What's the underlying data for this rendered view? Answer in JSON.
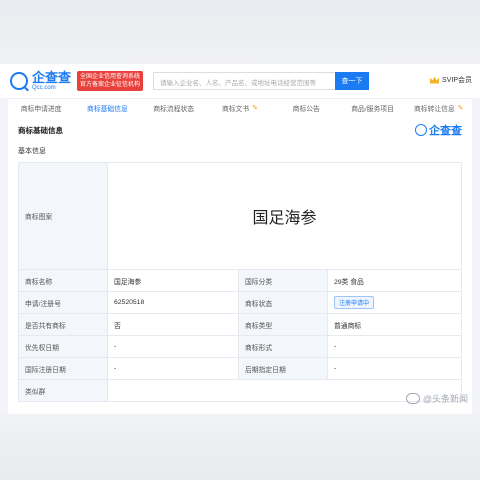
{
  "header": {
    "logo_cn": "企查查",
    "logo_en": "Qcc.com",
    "badge_line1": "全国企业信用查询系统",
    "badge_line2": "官方备案企业征信机构",
    "search_placeholder": "请输入企业名、人名、产品名、或地址电话经营范围等",
    "search_button": "查一下",
    "svip": "SVIP会员"
  },
  "tabs": [
    {
      "label": "商标申请进度",
      "vip": false
    },
    {
      "label": "商标基础信息",
      "vip": false
    },
    {
      "label": "商标流程状态",
      "vip": false
    },
    {
      "label": "商标文书",
      "vip": true
    },
    {
      "label": "商标公告",
      "vip": false
    },
    {
      "label": "商品/服务项目",
      "vip": false
    },
    {
      "label": "商标转让信息",
      "vip": true
    }
  ],
  "panel": {
    "title": "商标基础信息",
    "logo_text": "企查查",
    "section": "基本信息"
  },
  "details": {
    "image_label": "商标图案",
    "trademark_text": "国足海参",
    "rows": [
      {
        "k1": "商标名称",
        "v1": "国足海参",
        "k2": "国际分类",
        "v2": "29类 食品"
      },
      {
        "k1": "申请/注册号",
        "v1": "62520518",
        "k2": "商标状态",
        "v2": "注册申请中"
      },
      {
        "k1": "是否共有商标",
        "v1": "否",
        "k2": "商标类型",
        "v2": "普通商标"
      },
      {
        "k1": "优先权日期",
        "v1": "-",
        "k2": "商标形式",
        "v2": "-"
      },
      {
        "k1": "国际注册日期",
        "v1": "-",
        "k2": "后期指定日期",
        "v2": "-"
      }
    ],
    "similar_label": "类似群"
  },
  "watermark": "@头条新闻"
}
